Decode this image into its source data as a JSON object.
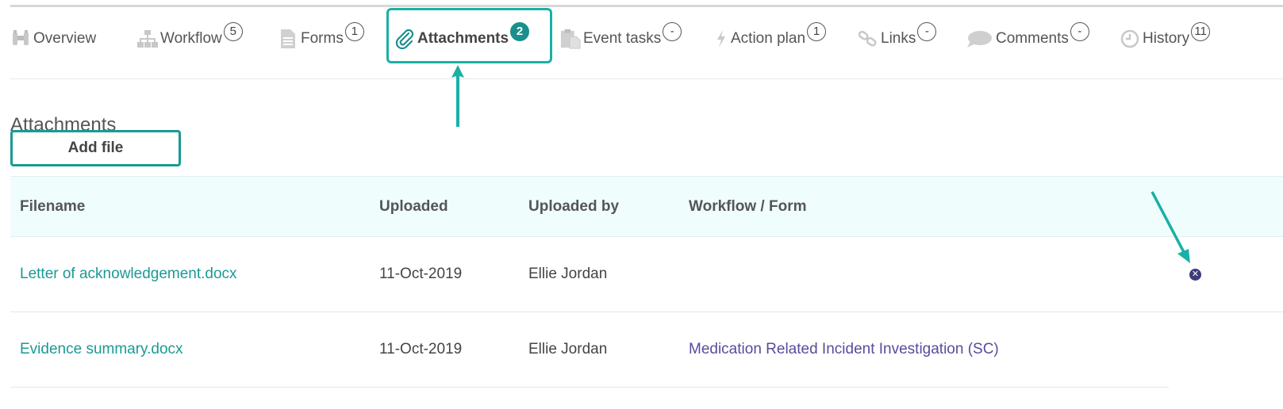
{
  "tabs": [
    {
      "label": "Overview",
      "count": "",
      "icon": "binoculars-icon"
    },
    {
      "label": "Workflow",
      "count": "5",
      "icon": "org-chart-icon"
    },
    {
      "label": "Forms",
      "count": "1",
      "icon": "document-icon"
    },
    {
      "label": "Attachments",
      "count": "2",
      "icon": "paperclip-icon",
      "active": true
    },
    {
      "label": "Event tasks",
      "count": "-",
      "icon": "clipboard-icon"
    },
    {
      "label": "Action plan",
      "count": "1",
      "icon": "lightning-icon"
    },
    {
      "label": "Links",
      "count": "-",
      "icon": "link-icon"
    },
    {
      "label": "Comments",
      "count": "-",
      "icon": "speech-bubble-icon"
    },
    {
      "label": "History",
      "count": "11",
      "icon": "clock-icon"
    }
  ],
  "section": {
    "title": "Attachments",
    "add_file_label": "Add file"
  },
  "table": {
    "headers": [
      "Filename",
      "Uploaded",
      "Uploaded by",
      "Workflow / Form"
    ],
    "rows": [
      {
        "filename": "Letter of acknowledgement.docx",
        "uploaded": "11-Oct-2019",
        "uploaded_by": "Ellie Jordan",
        "workflow_form": ""
      },
      {
        "filename": "Evidence summary.docx",
        "uploaded": "11-Oct-2019",
        "uploaded_by": "Ellie Jordan",
        "workflow_form": "Medication Related Incident Investigation (SC)"
      }
    ],
    "delete_glyph": "✕"
  },
  "colors": {
    "accent": "#1a9a94",
    "highlight_border": "#1ab0a6",
    "form_link": "#5b4a9c",
    "header_bg": "#effdfd"
  }
}
